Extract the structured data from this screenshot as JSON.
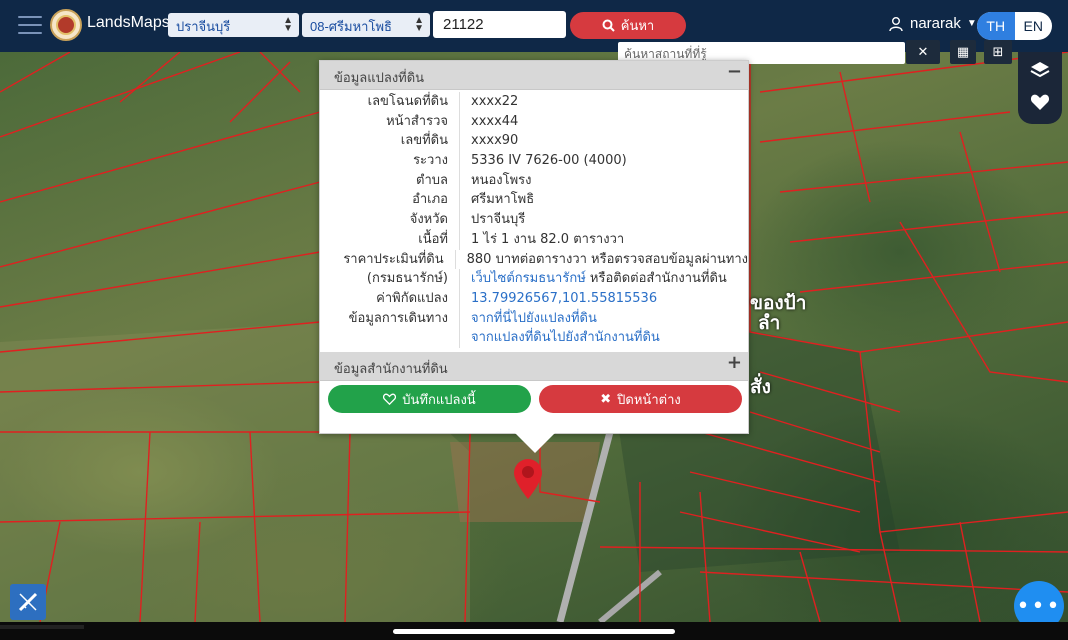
{
  "header": {
    "brand": "LandsMaps",
    "province": "ปราจีนบุรี",
    "district": "08-ศรีมหาโพธิ",
    "parcel_number": "21122",
    "search_label": "ค้นหา",
    "user": "nararak",
    "lang_th": "TH",
    "lang_en": "EN"
  },
  "map_search": {
    "placeholder": "ค้นหาสถานที่ที่รู้"
  },
  "popup": {
    "section1_title": "ข้อมูลแปลงที่ดิน",
    "section1_toggle": "−",
    "rows": [
      {
        "label": "เลขโฉนดที่ดิน",
        "value": "xxxx22"
      },
      {
        "label": "หน้าสำรวจ",
        "value": "xxxx44"
      },
      {
        "label": "เลขที่ดิน",
        "value": "xxxx90"
      },
      {
        "label": "ระวาง",
        "value": "5336 IV 7626-00 (4000)"
      },
      {
        "label": "ตำบล",
        "value": "หนองโพรง"
      },
      {
        "label": "อำเภอ",
        "value": "ศรีมหาโพธิ"
      },
      {
        "label": "จังหวัด",
        "value": "ปราจีนบุรี"
      },
      {
        "label": "เนื้อที่",
        "value": "1 ไร่ 1 งาน 82.0 ตารางวา"
      },
      {
        "label": "ราคาประเมินที่ดิน",
        "value": "880 บาทต่อตารางวา หรือตรวจสอบข้อมูลผ่านทาง"
      },
      {
        "label": "(กรมธนารักษ์)",
        "value_link": "เว็บไซต์กรมธนารักษ์",
        "value_rest": " หรือติดต่อสำนักงานที่ดิน"
      },
      {
        "label": "ค่าพิกัดแปลง",
        "value": "13.79926567,101.55815536"
      },
      {
        "label": "ข้อมูลการเดินทาง",
        "value": "จากที่นี่ไปยังแปลงที่ดิน"
      },
      {
        "label": "",
        "value": "จากแปลงที่ดินไปยังสำนักงานที่ดิน"
      }
    ],
    "section2_title": "ข้อมูลสำนักงานที่ดิน",
    "section2_toggle": "+",
    "save_label": "บันทึกแปลงนี้",
    "close_label": "ปิดหน้าต่าง"
  },
  "map_labels": {
    "label1": "ของป้า",
    "label2": "ลำ",
    "label3": "สั่ง"
  },
  "icons": {
    "menu": "hamburger-icon",
    "search": "search-icon",
    "user": "user-icon",
    "layers": "layers-icon",
    "favorites": "heart-icon",
    "measure": "ruler-icon",
    "more": "more-icon",
    "marker": "map-pin-icon"
  },
  "colors": {
    "header_bg": "#0f2847",
    "accent_red": "#d63a3f",
    "accent_green": "#22a24a",
    "accent_blue": "#2f7fe0",
    "parcel_line": "#e02020"
  }
}
